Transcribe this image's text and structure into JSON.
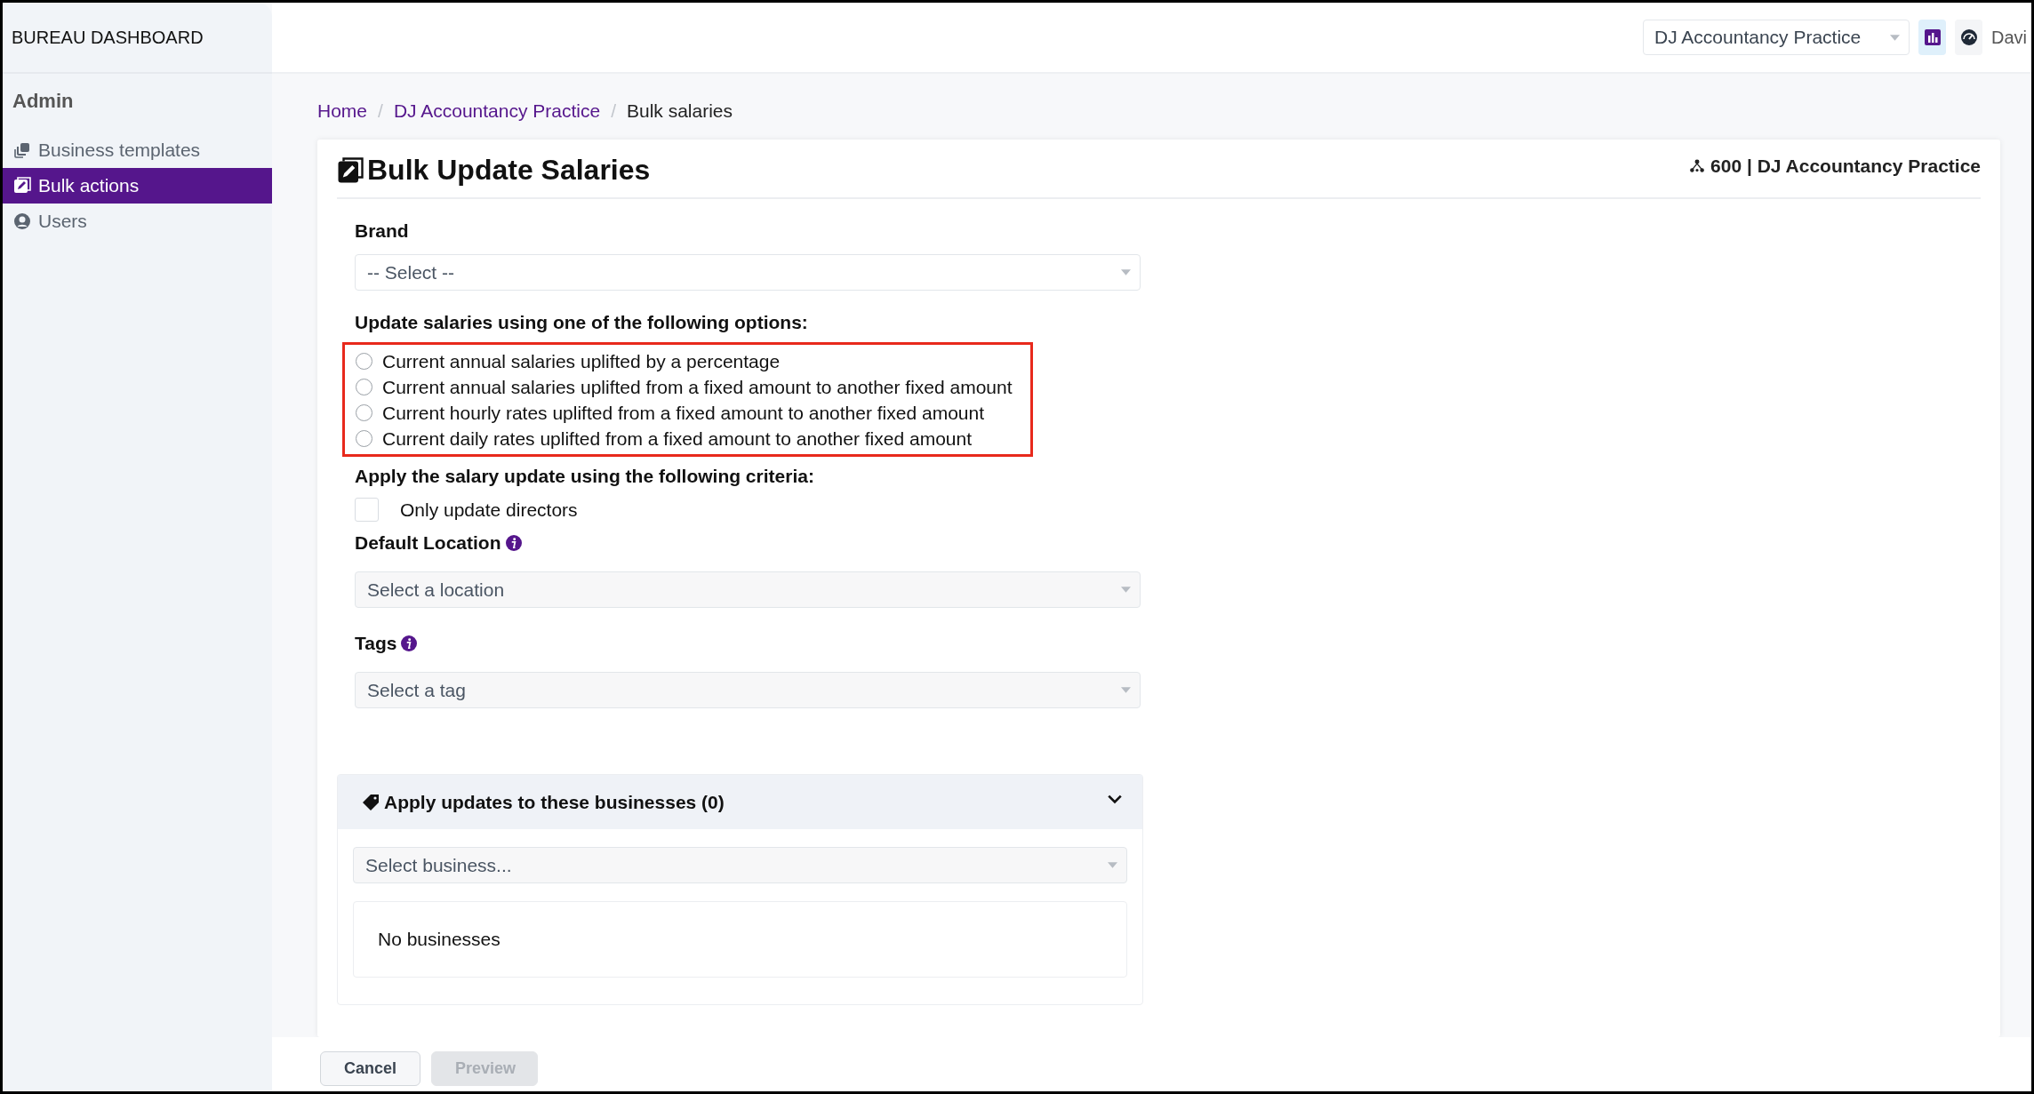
{
  "sidebar": {
    "brand": "BUREAU DASHBOARD",
    "section": "Admin",
    "items": [
      {
        "label": "Business templates",
        "selected": false
      },
      {
        "label": "Bulk actions",
        "selected": true
      },
      {
        "label": "Users",
        "selected": false
      }
    ]
  },
  "top_bar": {
    "practice_select": {
      "value": "DJ Accountancy Practice"
    },
    "icon_buttons": [
      {
        "selected": true
      },
      {
        "selected": false
      }
    ],
    "user": "Davi"
  },
  "breadcrumb": [
    {
      "label": "Home",
      "kind": "link"
    },
    {
      "label": "/",
      "kind": "separator"
    },
    {
      "label": "DJ Accountancy Practice",
      "kind": "link"
    },
    {
      "label": "/",
      "kind": "separator"
    },
    {
      "label": "Bulk salaries",
      "kind": "current"
    }
  ],
  "card": {
    "title": "Bulk Update Salaries",
    "meta": "600 | DJ Accountancy Practice",
    "brand": {
      "label": "Brand",
      "placeholder": "-- Select --"
    },
    "options_label": "Update salaries using one of the following options:",
    "options_highlighted": true,
    "options": [
      {
        "label": "Current annual salaries uplifted by a percentage",
        "selected": false
      },
      {
        "label": "Current annual salaries uplifted from a fixed amount to another fixed amount",
        "selected": false
      },
      {
        "label": "Current hourly rates uplifted from a fixed amount to another fixed amount",
        "selected": false
      },
      {
        "label": "Current daily rates uplifted from a fixed amount to another fixed amount",
        "selected": false
      }
    ],
    "criteria_label": "Apply the salary update using the following criteria:",
    "directors": {
      "label": "Only update directors",
      "checked": false
    },
    "location": {
      "label": "Default Location",
      "placeholder": "Select a location"
    },
    "tags": {
      "label": "Tags",
      "placeholder": "Select a tag"
    },
    "businesses": {
      "title": "Apply updates to these businesses (0)",
      "expanded": true,
      "placeholder": "Select business...",
      "empty_text": "No businesses"
    }
  },
  "buttons": [
    {
      "label": "Cancel",
      "disabled": false
    },
    {
      "label": "Preview",
      "disabled": true
    }
  ]
}
